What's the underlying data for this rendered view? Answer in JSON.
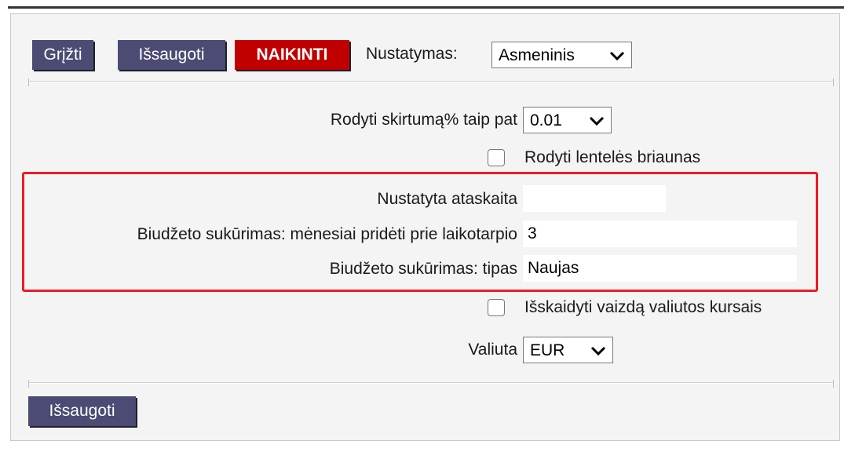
{
  "toolbar": {
    "back_label": "Grįžti",
    "save_label": "Išsaugoti",
    "delete_label": "NAIKINTI",
    "setting_label": "Nustatymas:",
    "setting_value": "Asmeninis"
  },
  "form": {
    "diff_label": "Rodyti skirtumą% taip pat",
    "diff_value": "0.01",
    "borders_label": "Rodyti lentelės briaunas",
    "report_label": "Nustatyta ataskaita",
    "report_value": "",
    "months_label": "Biudžeto sukūrimas: mėnesiai pridėti prie laikotarpio",
    "months_value": "3",
    "type_label": "Biudžeto sukūrimas: tipas",
    "type_value": "Naujas",
    "split_label": "Išskaidyti vaizdą valiutos kursais",
    "currency_label": "Valiuta",
    "currency_value": "EUR"
  },
  "footer": {
    "save_label": "Išsaugoti"
  },
  "colors": {
    "button_dark": "#4b4b73",
    "button_delete": "#c00000",
    "highlight": "#ee1b24"
  }
}
